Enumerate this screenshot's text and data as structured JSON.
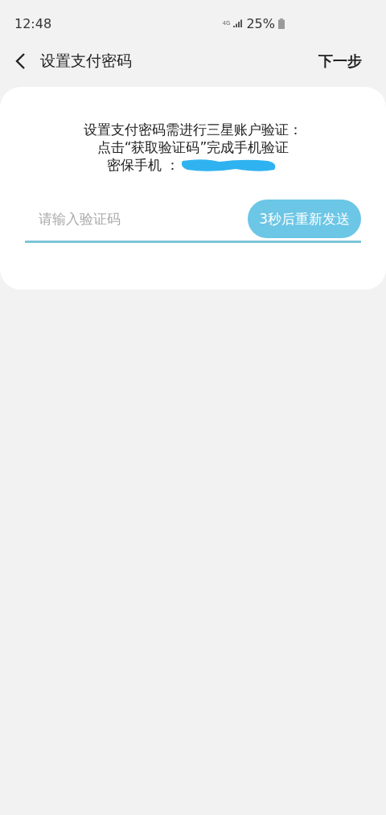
{
  "status_bar": {
    "time": "12:48",
    "network": "4G",
    "battery": "25%"
  },
  "header": {
    "title": "设置支付密码",
    "action": "下一步"
  },
  "card": {
    "lines": [
      "设置支付密码需进行三星账户验证：",
      "点击“获取验证码”完成手机验证",
      "密保手机 ："
    ],
    "phone_redacted": true,
    "code_field": {
      "placeholder": "请输入验证码"
    },
    "resend_button": {
      "label": "3秒后重新发送",
      "disabled": true
    }
  }
}
